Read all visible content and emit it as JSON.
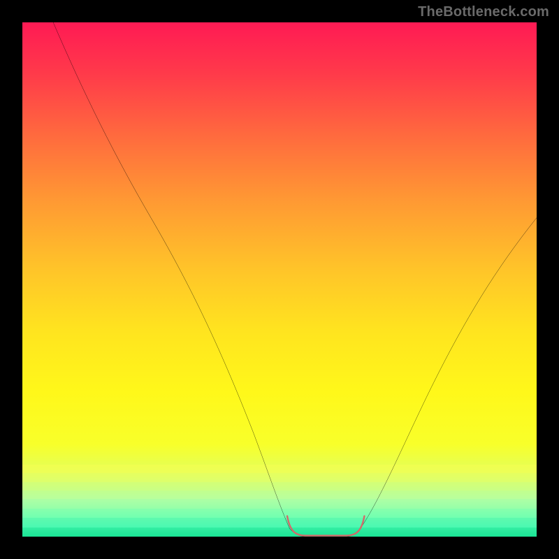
{
  "watermark": {
    "text": "TheBottleneck.com"
  },
  "chart_data": {
    "type": "line",
    "title": "",
    "xlabel": "",
    "ylabel": "",
    "xlim": [
      0,
      100
    ],
    "ylim": [
      0,
      100
    ],
    "grid": false,
    "legend": null,
    "series": [
      {
        "name": "bottleneck-curve",
        "x": [
          6,
          10,
          15,
          20,
          25,
          30,
          35,
          40,
          45,
          48,
          50,
          52,
          55,
          58,
          60,
          62,
          64,
          68,
          72,
          76,
          80,
          85,
          90,
          95,
          100
        ],
        "y": [
          100,
          92,
          82,
          72,
          62,
          52,
          42,
          32,
          20,
          10,
          4,
          1,
          0,
          0,
          0,
          0,
          1,
          4,
          10,
          18,
          26,
          36,
          46,
          54,
          62
        ]
      }
    ],
    "annotations": [
      {
        "name": "optimal-range-marker",
        "x_range": [
          52,
          64
        ],
        "y": 0,
        "color": "#d26a6a"
      }
    ],
    "background_gradient": {
      "stops": [
        {
          "pos": 0.0,
          "color": "#ff1a54"
        },
        {
          "pos": 0.5,
          "color": "#ffd625"
        },
        {
          "pos": 0.85,
          "color": "#f6ff40"
        },
        {
          "pos": 1.0,
          "color": "#18e890"
        }
      ]
    }
  }
}
